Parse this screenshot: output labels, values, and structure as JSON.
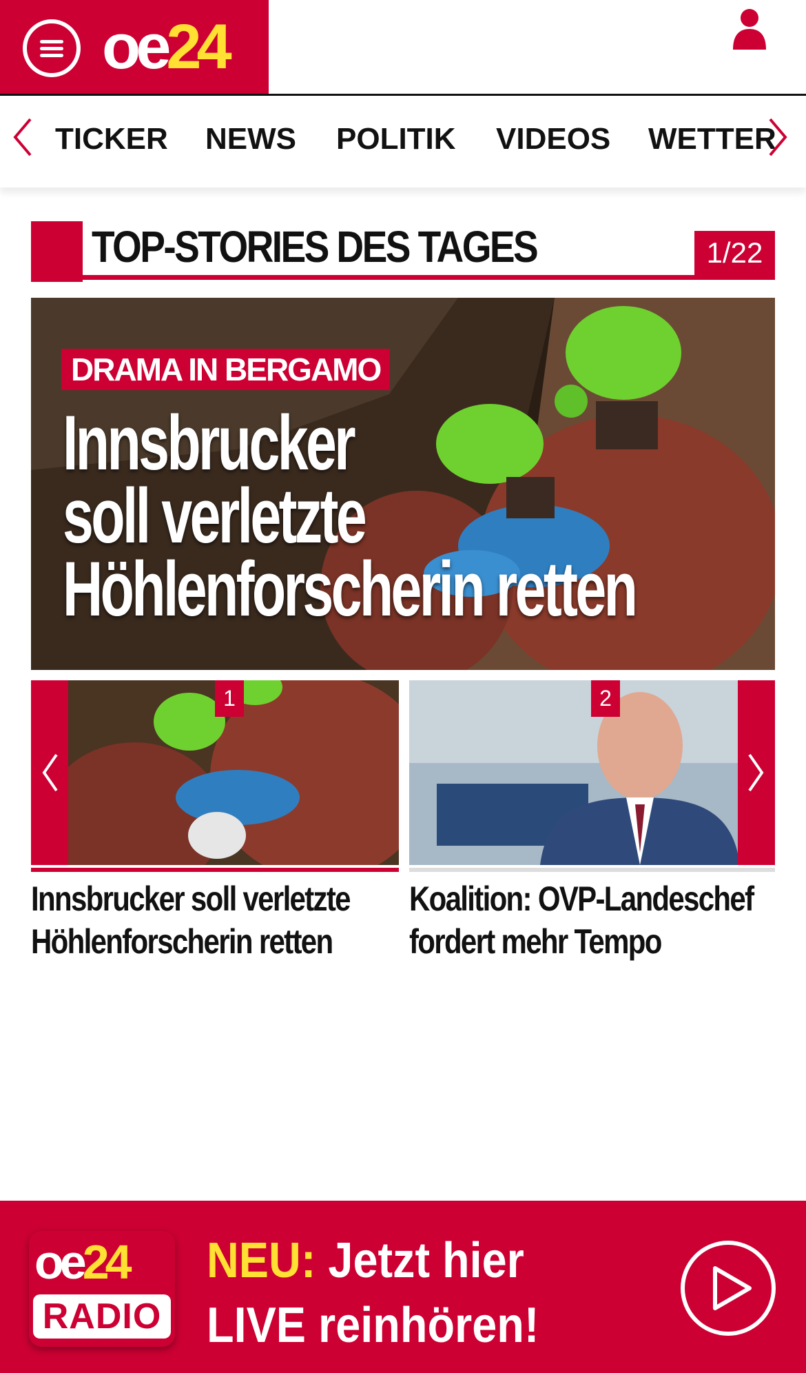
{
  "header": {
    "logo_oe": "oe",
    "logo_24": "24",
    "menu_icon": "hamburger-menu-icon",
    "user_icon": "user-icon"
  },
  "nav": {
    "items": [
      {
        "label": "TICKER"
      },
      {
        "label": "NEWS"
      },
      {
        "label": "POLITIK"
      },
      {
        "label": "VIDEOS"
      },
      {
        "label": "WETTER"
      }
    ]
  },
  "section": {
    "title": "TOP-STORIES DES TAGES",
    "counter": "1/22"
  },
  "hero": {
    "kicker": "DRAMA IN BERGAMO",
    "headline_lines": [
      "Innsbrucker",
      "soll verletzte",
      "Höhlenforscherin retten"
    ]
  },
  "carousel": {
    "items": [
      {
        "number": "1",
        "title_lines": [
          "Innsbrucker soll verletzte",
          "Höhlenforscherin retten"
        ]
      },
      {
        "number": "2",
        "title_lines": [
          "Koalition: OVP-Landeschef",
          "fordert mehr Tempo"
        ]
      }
    ]
  },
  "radio": {
    "logo_oe": "oe",
    "logo_24": "24",
    "logo_radio": "RADIO",
    "neu": "NEU:",
    "line1_rest": " Jetzt hier",
    "line2": "LIVE reinhören!"
  },
  "colors": {
    "brand_red": "#cc0033",
    "brand_yellow": "#ffe033",
    "helmet_green": "#6fd12f"
  }
}
